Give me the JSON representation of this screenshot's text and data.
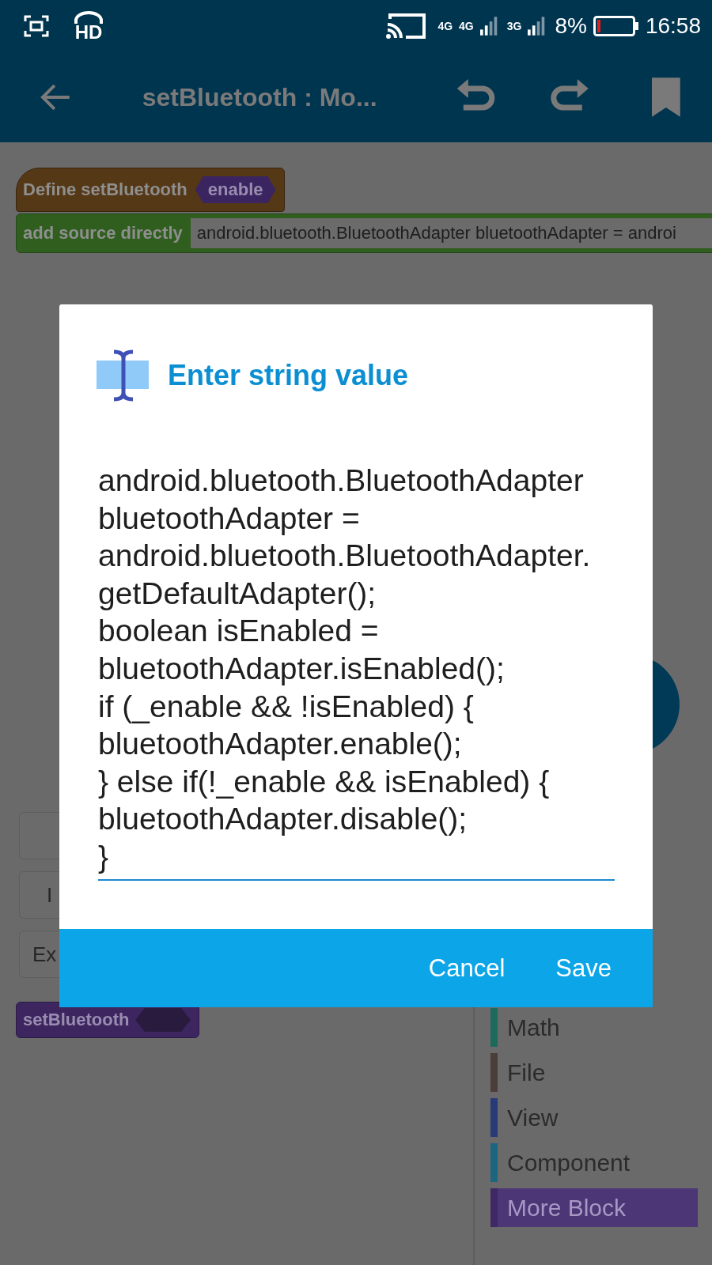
{
  "status_bar": {
    "hd_label": "HD",
    "network_labels": [
      "4G",
      "4G",
      "3G"
    ],
    "battery_percent": "8%",
    "time": "16:58"
  },
  "app_bar": {
    "title": "setBluetooth : Mo..."
  },
  "canvas": {
    "define_block": {
      "label": "Define setBluetooth",
      "parameter": "enable"
    },
    "source_block": {
      "label": "add source directly",
      "value": "android.bluetooth.BluetoothAdapter bluetoothAdapter = androi"
    },
    "side_buttons": [
      {
        "kind": "empty"
      },
      {
        "kind": "text",
        "label": "I"
      },
      {
        "kind": "text",
        "label": "Ex"
      }
    ],
    "call_block": {
      "label": "setBluetooth"
    }
  },
  "palette": {
    "items": [
      {
        "label": "Math",
        "color": "#1b6a5c",
        "selected": false
      },
      {
        "label": "File",
        "color": "#4b3e3a",
        "selected": false
      },
      {
        "label": "View",
        "color": "#283a78",
        "selected": false
      },
      {
        "label": "Component",
        "color": "#1d6680",
        "selected": false
      },
      {
        "label": "More Block",
        "color": "#3f2866",
        "selected": true
      }
    ]
  },
  "dialog": {
    "title": "Enter string value",
    "lines": [
      "android.bluetooth.BluetoothAdapter",
      "bluetoothAdapter =",
      "android.bluetooth.BluetoothAdapter.",
      "getDefaultAdapter();",
      "boolean isEnabled =",
      "bluetoothAdapter.isEnabled();",
      "if (_enable && !isEnabled) {",
      "bluetoothAdapter.enable();",
      "} else if(!_enable && isEnabled) {",
      "bluetoothAdapter.disable();",
      "}"
    ],
    "buttons": [
      "Cancel",
      "Save"
    ]
  }
}
